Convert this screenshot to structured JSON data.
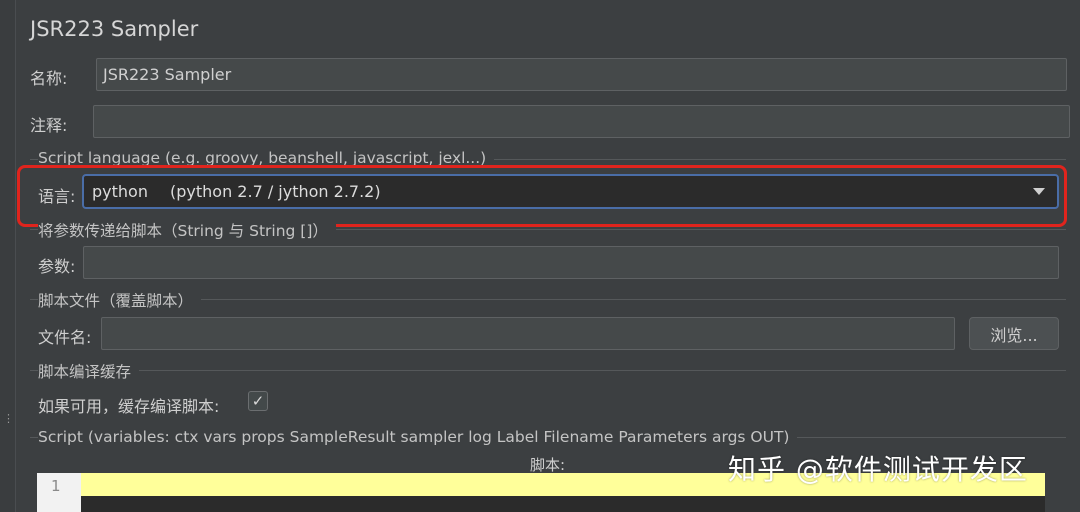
{
  "title": "JSR223 Sampler",
  "name_field": {
    "label": "名称:",
    "value": "JSR223 Sampler"
  },
  "comment_field": {
    "label": "注释:",
    "value": ""
  },
  "script_language_group": {
    "title": "Script language (e.g. groovy, beanshell, javascript, jexl...)",
    "label": "语言:",
    "selected_value": "python",
    "selected_desc": "(python 2.7 / jython 2.7.2)"
  },
  "params_group": {
    "title": "将参数传递给脚本（String 与 String []）",
    "label": "参数:",
    "value": ""
  },
  "script_file_group": {
    "title": "脚本文件（覆盖脚本）",
    "label": "文件名:",
    "value": "",
    "browse_label": "浏览..."
  },
  "cache_group": {
    "title": "脚本编译缓存",
    "label": "如果可用，缓存编译脚本:",
    "checked": true,
    "check_glyph": "✓"
  },
  "script_group": {
    "title": "Script (variables: ctx vars props SampleResult sampler log Label Filename Parameters args OUT)",
    "editor_label": "脚本:",
    "line_number": "1"
  },
  "watermark": "知乎 @软件测试开发区",
  "colors": {
    "background": "#3c3f41",
    "highlight_border": "#e0241d",
    "select_focus": "#4a6da7",
    "line_highlight": "#ffff9a"
  }
}
